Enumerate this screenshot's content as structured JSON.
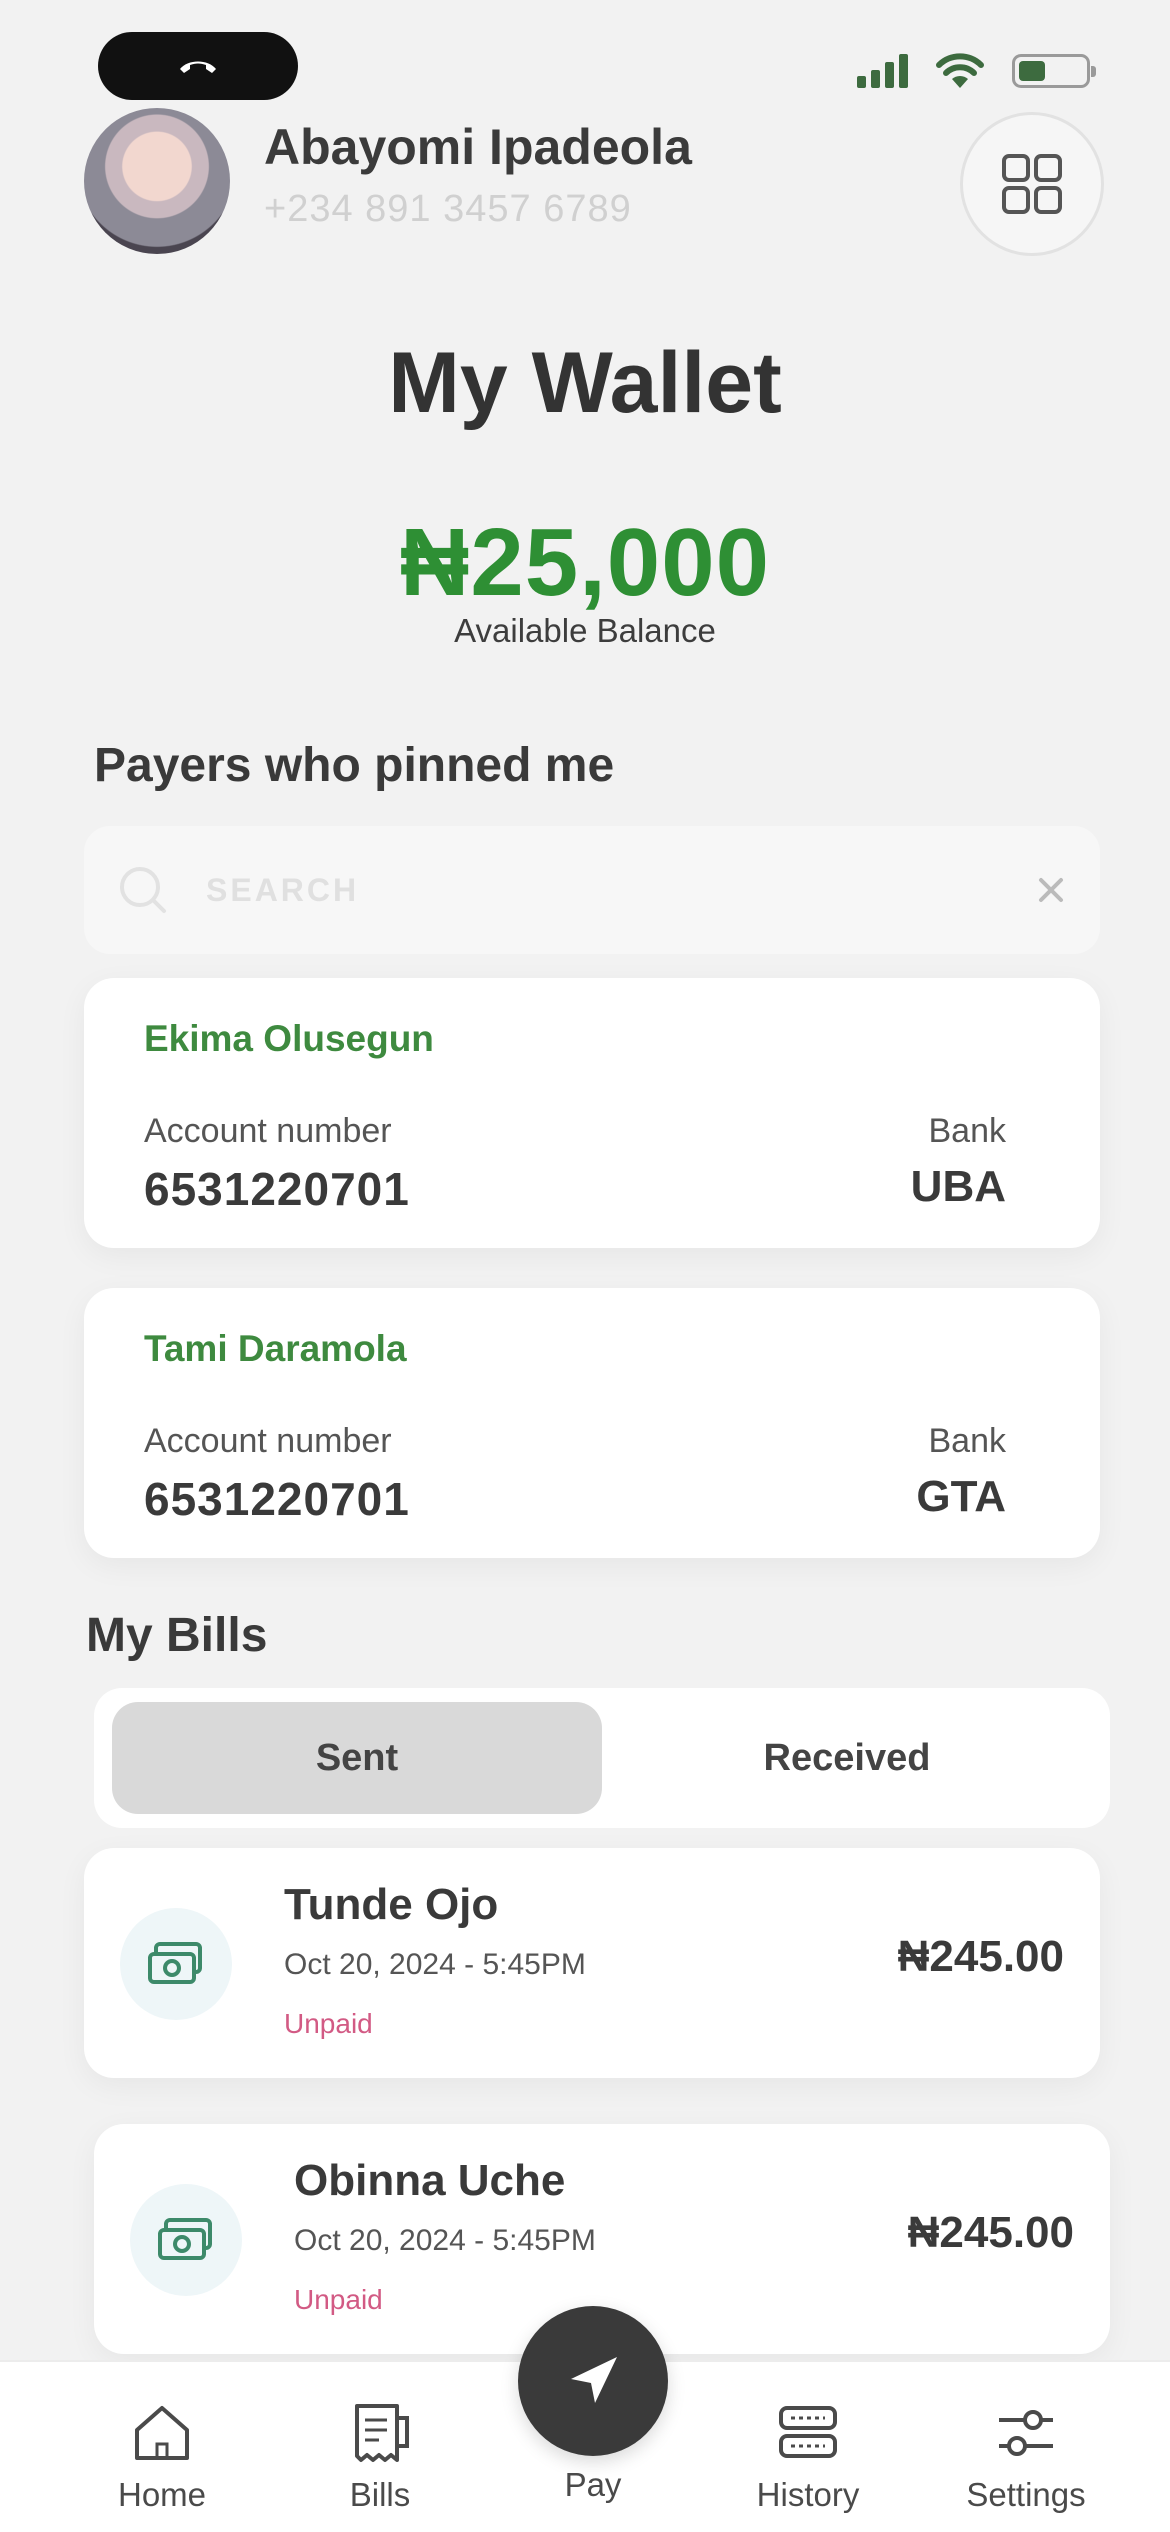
{
  "status_bar": {
    "call_icon": "phone-end-icon",
    "wifi_icon": "wifi-icon",
    "battery_icon": "battery-icon",
    "signal_icon": "signal-icon"
  },
  "header": {
    "user_name": "Abayomi Ipadeola",
    "user_phone": "+234 891 3457 6789",
    "menu_icon": "grid-icon"
  },
  "wallet": {
    "title": "My Wallet",
    "balance": "₦25,000",
    "balance_label": "Available Balance"
  },
  "payers": {
    "section_title": "Payers who pinned me",
    "search_placeholder": "SEARCH",
    "items": [
      {
        "name": "Ekima Olusegun",
        "account_label": "Account number",
        "account_number": "6531220701",
        "bank_label": "Bank",
        "bank": "UBA"
      },
      {
        "name": "Tami Daramola",
        "account_label": "Account number",
        "account_number": "6531220701",
        "bank_label": "Bank",
        "bank": "GTA"
      }
    ]
  },
  "bills": {
    "section_title": "My Bills",
    "tabs": [
      {
        "label": "Sent",
        "active": true
      },
      {
        "label": "Received",
        "active": false
      }
    ],
    "items": [
      {
        "name": "Tunde Ojo",
        "date": "Oct 20, 2024 - 5:45PM",
        "status": "Unpaid",
        "amount": "₦245.00",
        "icon": "money-icon"
      },
      {
        "name": "Obinna Uche",
        "date": "Oct 20, 2024 - 5:45PM",
        "status": "Unpaid",
        "amount": "₦245.00",
        "icon": "money-icon"
      }
    ]
  },
  "tabbar": {
    "items": [
      {
        "label": "Home",
        "icon": "home-icon"
      },
      {
        "label": "Bills",
        "icon": "receipt-icon"
      },
      {
        "label": "Pay",
        "icon": "send-icon"
      },
      {
        "label": "History",
        "icon": "server-icon"
      },
      {
        "label": "Settings",
        "icon": "sliders-icon"
      }
    ]
  },
  "colors": {
    "accent_green": "#2e8f34",
    "payer_name_green": "#3e8a3f",
    "unpaid_pink": "#d25a84",
    "dark": "#3a3a3a"
  }
}
